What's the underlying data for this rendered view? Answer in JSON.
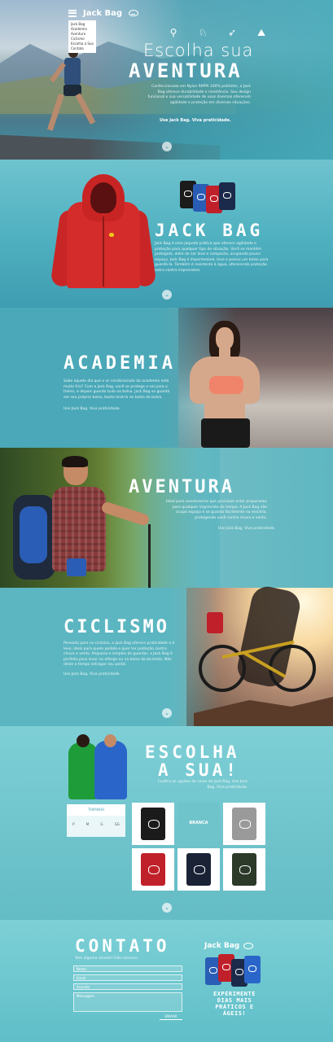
{
  "nav": {
    "brand": "Jack Bag",
    "menu_items": [
      "Jack Bag",
      "Academia",
      "Aventura",
      "Ciclismo",
      "Escolha a Sua",
      "Contato"
    ]
  },
  "hero": {
    "title_line1": "Escolha sua",
    "title_line2": "AVENTURA",
    "text": "Confeccionada em Nylon RIPPA 100% poliéster, a Jack Bag oferece durabilidade e resistência. Seu design funcional e sua versatilidade de usos diversos oferecem agilidade e proteção em diversas situações.",
    "signature": "Use Jack Bag. Viva praticidade.",
    "sport_icons": [
      "bike-icon",
      "cyclist-icon",
      "runner-icon",
      "climber-icon"
    ]
  },
  "jackbag": {
    "title": "JACK BAG",
    "text": "Jack Bag é uma jaqueta prática que oferece agilidade e proteção para qualquer tipo de situação. Você se mantém protegido, além de ser leve e compacta, ocupando pouco espaço. Jack Bag é impermeável, leve e possui um bolso para guardá-la. Também é resistente à água, oferecendo proteção extra contra imprevistos."
  },
  "academia": {
    "title": "ACADEMIA",
    "text": "Sabe aquele dia que o ar condicionado da academia está muito frio? Com a Jack Bag, você se protege e sai para o treino, e depois guarda tudo no bolso. Jack Bag se guarda em seu próprio bolso, basta levá-la no bolso da bolsa.",
    "signature": "Use Jack Bag. Viva praticidade."
  },
  "aventura": {
    "title": "AVENTURA",
    "text": "Ideal para aventureiros que precisam estar preparados para qualquer imprevisto do tempo. A Jack Bag não ocupa espaço e se guarda facilmente na mochila, protegendo você contra chuva e vento.",
    "signature": "Use Jack Bag. Viva praticidade."
  },
  "ciclismo": {
    "title": "CICLISMO",
    "text": "Pensada para os ciclistas, a Jack Bag oferece praticidade e é leve, ideal para quem pedala e quer ter proteção contra chuva e vento. Pequena e simples de guardar, a Jack Bag é perfeita para levar no alforge ou na bolsa da bicicleta. Não deixe o tempo estragar seu pedal.",
    "signature": "Use Jack Bag. Viva praticidade."
  },
  "escolha": {
    "title_line1": "ESCOLHA",
    "title_line2": "A SUA!",
    "text": "Confira as opções de cores da Jack Bag. Use Jack Bag. Viva praticidade.",
    "size_header": "TAMANHO",
    "sizes": [
      "P",
      "M",
      "G",
      "GG"
    ],
    "selected_color_label": "BRANCA",
    "colors": [
      {
        "name": "black",
        "hex": "#1b1b1b"
      },
      {
        "name": "white",
        "hex": "#ffffff"
      },
      {
        "name": "grey",
        "hex": "#9a9a9a"
      },
      {
        "name": "red",
        "hex": "#c0202a"
      },
      {
        "name": "navy",
        "hex": "#1b2236"
      },
      {
        "name": "camo",
        "hex": "#2d3a2a"
      }
    ]
  },
  "contato": {
    "title": "CONTATO",
    "subtitle": "Tem alguma dúvida? Fale conosco.",
    "fields": [
      "Nome",
      "Email",
      "Assunto",
      "Mensagem"
    ],
    "send_label": "ENVIAR",
    "brand": "Jack Bag",
    "tagline": "EXPERIMENTE DIAS MAIS PRÁTICOS E ÁGEIS!"
  },
  "colors": {
    "teal": "#4aa8b8",
    "red": "#d42b2b",
    "blue": "#2a5db5"
  }
}
